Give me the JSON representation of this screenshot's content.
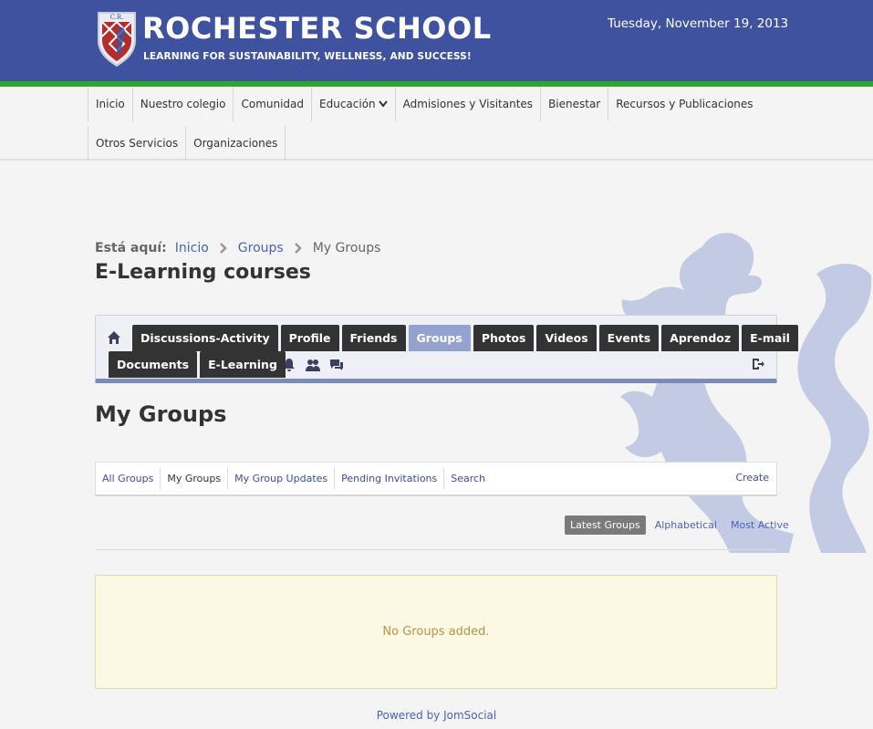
{
  "header": {
    "title": "ROCHESTER SCHOOL",
    "tagline": "LEARNING FOR SUSTAINABILITY, WELLNESS, AND SUCCESS!",
    "date": "Tuesday, November 19, 2013",
    "logo_initials": "C.R.",
    "colors": {
      "header_bg": "#3f52a0",
      "accent_green": "#2fa52f"
    }
  },
  "main_nav": {
    "row1": [
      "Inicio",
      "Nuestro colegio",
      "Comunidad",
      "Educación",
      "Admisiones y Visitantes",
      "Bienestar",
      "Recursos y Publicaciones"
    ],
    "row2": [
      "Otros Servicios",
      "Organizaciones"
    ]
  },
  "breadcrumb": {
    "label": "Está aquí:",
    "items": [
      "Inicio",
      "Groups"
    ],
    "current": "My Groups"
  },
  "page_title": "E-Learning courses",
  "toolbar": {
    "tabs_row1": [
      "Discussions-Activity",
      "Profile",
      "Friends",
      "Groups",
      "Photos",
      "Videos",
      "Events",
      "Aprendoz",
      "E-mail"
    ],
    "tabs_row2": [
      "Documents",
      "E-Learning"
    ],
    "active_tab": "Groups",
    "icons": [
      "home-icon",
      "notification-bell-icon",
      "friends-requests-icon",
      "messages-icon",
      "logout-icon"
    ]
  },
  "section_title": "My Groups",
  "subnav": {
    "items": [
      "All Groups",
      "My Groups",
      "My Group Updates",
      "Pending Invitations",
      "Search"
    ],
    "current": "My Groups",
    "create": "Create"
  },
  "sort": {
    "active": "Latest Groups",
    "options": [
      "Alphabetical",
      "Most Active"
    ]
  },
  "notice": "No Groups added.",
  "footer": "Powered by JomSocial"
}
